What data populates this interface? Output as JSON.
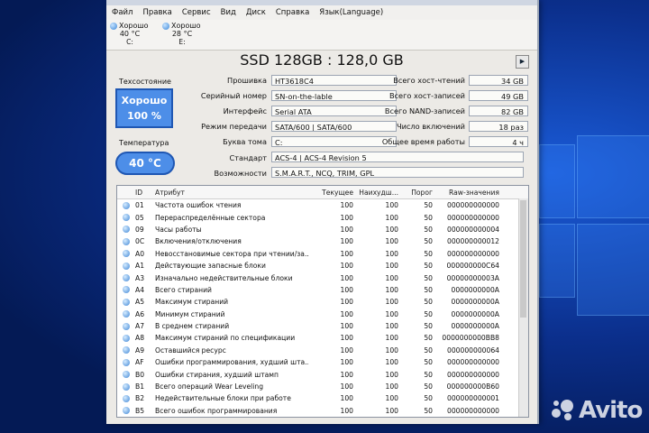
{
  "menu": [
    "Файл",
    "Правка",
    "Сервис",
    "Вид",
    "Диск",
    "Справка",
    "Язык(Language)"
  ],
  "drives": [
    {
      "status": "Хорошо",
      "temp": "40 °C",
      "letter": "C:"
    },
    {
      "status": "Хорошо",
      "temp": "28 °C",
      "letter": "E:"
    }
  ],
  "model": "SSD 128GB : 128,0 GB",
  "nav": "▶",
  "health": {
    "label": "Техсостояние",
    "status": "Хорошо",
    "percent": "100 %"
  },
  "temperature": {
    "label": "Температура",
    "value": "40 °C"
  },
  "info": {
    "firmware_label": "Прошивка",
    "firmware": "HT3618C4",
    "serial_label": "Серийный номер",
    "serial": "SN-on-the-lable",
    "interface_label": "Интерфейс",
    "interface": "Serial ATA",
    "transfer_label": "Режим передачи",
    "transfer": "SATA/600 | SATA/600",
    "volume_label": "Буква тома",
    "volume": "C:",
    "standard_label": "Стандарт",
    "standard": "ACS-4 | ACS-4 Revision 5",
    "features_label": "Возможности",
    "features": "S.M.A.R.T., NCQ, TRIM, GPL"
  },
  "stats": {
    "host_reads_label": "Всего хост-чтений",
    "host_reads": "34 GB",
    "host_writes_label": "Всего хост-записей",
    "host_writes": "49 GB",
    "nand_writes_label": "Всего NAND-записей",
    "nand_writes": "82 GB",
    "power_count_label": "Число включений",
    "power_count": "18 раз",
    "power_time_label": "Общее время работы",
    "power_time": "4 ч"
  },
  "table": {
    "headers": [
      "ID",
      "Атрибут",
      "Текущее",
      "Наихудш...",
      "Порог",
      "Raw-значения"
    ],
    "rows": [
      [
        "01",
        "Частота ошибок чтения",
        "100",
        "100",
        "50",
        "000000000000"
      ],
      [
        "05",
        "Перераспределённые сектора",
        "100",
        "100",
        "50",
        "000000000000"
      ],
      [
        "09",
        "Часы работы",
        "100",
        "100",
        "50",
        "000000000004"
      ],
      [
        "0C",
        "Включения/отключения",
        "100",
        "100",
        "50",
        "000000000012"
      ],
      [
        "A0",
        "Невосстановимые сектора при чтении/за...",
        "100",
        "100",
        "50",
        "000000000000"
      ],
      [
        "A1",
        "Действующие запасные блоки",
        "100",
        "100",
        "50",
        "000000000C64"
      ],
      [
        "A3",
        "Изначально недействительные блоки",
        "100",
        "100",
        "50",
        "00000000003A"
      ],
      [
        "A4",
        "Всего стираний",
        "100",
        "100",
        "50",
        "0000000000A"
      ],
      [
        "A5",
        "Максимум стираний",
        "100",
        "100",
        "50",
        "0000000000A"
      ],
      [
        "A6",
        "Минимум стираний",
        "100",
        "100",
        "50",
        "0000000000A"
      ],
      [
        "A7",
        "В среднем стираний",
        "100",
        "100",
        "50",
        "0000000000A"
      ],
      [
        "A8",
        "Максимум стираний по спецификации",
        "100",
        "100",
        "50",
        "0000000000BB8"
      ],
      [
        "A9",
        "Оставшийся ресурс",
        "100",
        "100",
        "50",
        "000000000064"
      ],
      [
        "AF",
        "Ошибки программирования, худший шта...",
        "100",
        "100",
        "50",
        "000000000000"
      ],
      [
        "B0",
        "Ошибки стирания, худший штамп",
        "100",
        "100",
        "50",
        "000000000000"
      ],
      [
        "B1",
        "Всего операций Wear Leveling",
        "100",
        "100",
        "50",
        "000000000B60"
      ],
      [
        "B2",
        "Недействительные блоки при работе",
        "100",
        "100",
        "50",
        "000000000001"
      ],
      [
        "B5",
        "Всего ошибок программирования",
        "100",
        "100",
        "50",
        "000000000000"
      ]
    ]
  },
  "watermark": "Avito"
}
